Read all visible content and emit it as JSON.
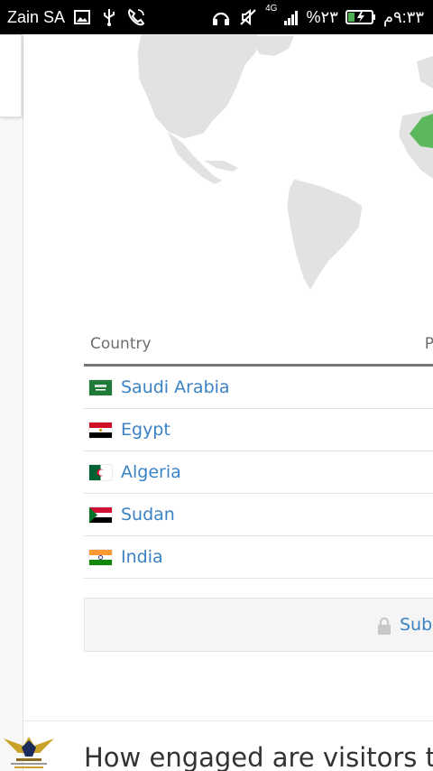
{
  "status_bar": {
    "carrier": "Zain SA",
    "network": "4G",
    "battery_percent": "%٢٣",
    "time": "٩:٣٣م"
  },
  "table": {
    "header": {
      "country": "Country",
      "col2": "P"
    },
    "rows": [
      {
        "country": "Saudi Arabia",
        "flag": "sa-flag-icon"
      },
      {
        "country": "Egypt",
        "flag": "eg-flag-icon"
      },
      {
        "country": "Algeria",
        "flag": "dz-flag-icon"
      },
      {
        "country": "Sudan",
        "flag": "sd-flag-icon"
      },
      {
        "country": "India",
        "flag": "in-flag-icon"
      }
    ]
  },
  "subscribe": {
    "label": "Subs"
  },
  "section": {
    "heading": "How engaged are visitors to d"
  },
  "colors": {
    "link": "#3a82c4",
    "map_land": "#e2e2e2",
    "map_highlight": "#5cb85c"
  }
}
